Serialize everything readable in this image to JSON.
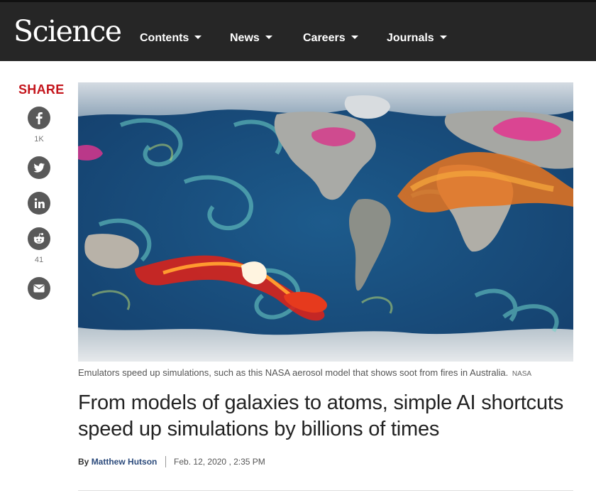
{
  "header": {
    "logo": "Science",
    "nav": [
      {
        "label": "Contents"
      },
      {
        "label": "News"
      },
      {
        "label": "Careers"
      },
      {
        "label": "Journals"
      }
    ]
  },
  "share": {
    "title": "SHARE",
    "buttons": [
      {
        "icon": "facebook-icon",
        "count": "1K"
      },
      {
        "icon": "twitter-icon",
        "count": ""
      },
      {
        "icon": "linkedin-icon",
        "count": ""
      },
      {
        "icon": "reddit-icon",
        "count": "41"
      },
      {
        "icon": "email-icon",
        "count": ""
      }
    ]
  },
  "article": {
    "caption": "Emulators speed up simulations, such as this NASA aerosol model that shows soot from fires in Australia.",
    "credit": "NASA",
    "headline": "From models of galaxies to atoms, simple AI shortcuts speed up simulations by billions of times",
    "byline_prefix": "By",
    "author": "Matthew Hutson",
    "date": "Feb. 12, 2020 , 2:35 PM"
  },
  "colors": {
    "header_bg": "#262626",
    "share_red": "#c4151c",
    "icon_gray": "#595959",
    "author_blue": "#2c4b7c"
  }
}
